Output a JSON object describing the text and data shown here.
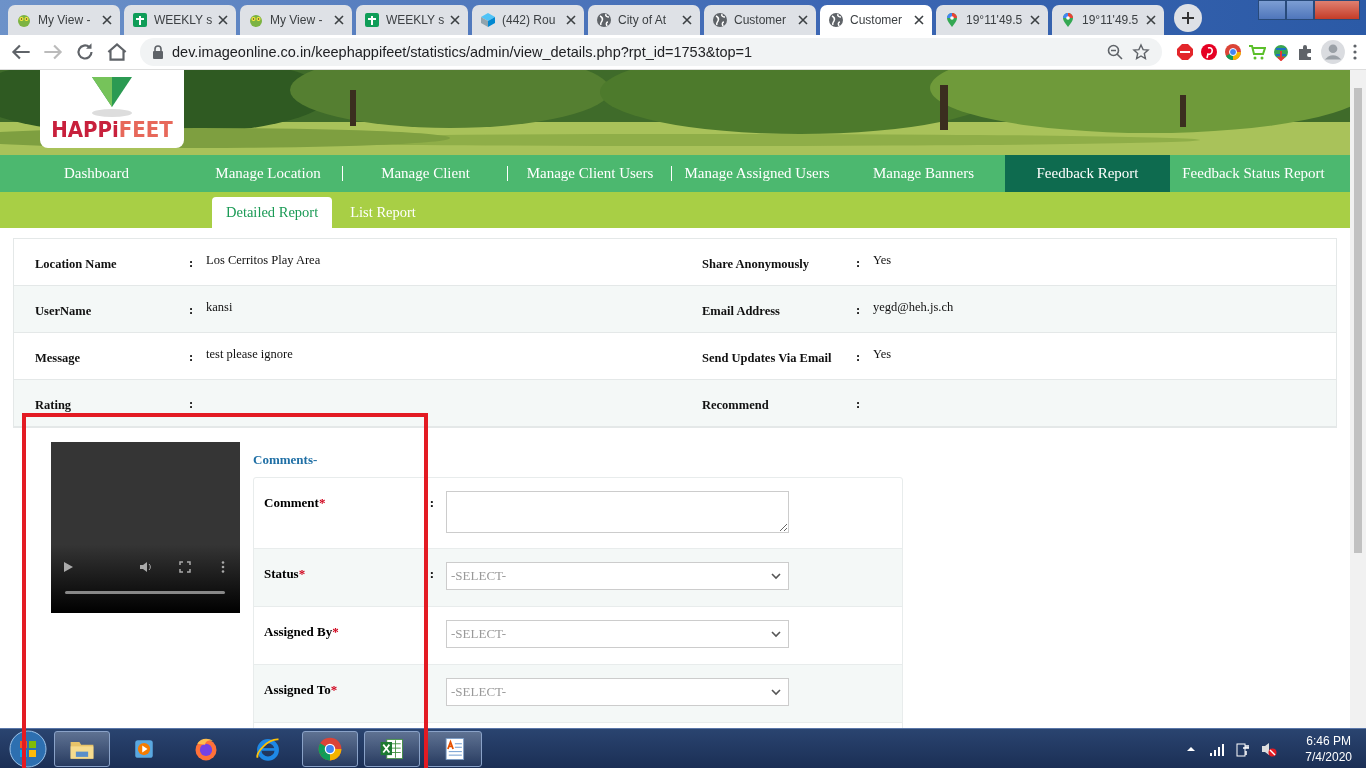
{
  "browser": {
    "tabs": [
      {
        "title": "My View -",
        "kind": "bug",
        "selected": false
      },
      {
        "title": "WEEKLY s",
        "kind": "sheet",
        "selected": false
      },
      {
        "title": "My View -",
        "kind": "bug",
        "selected": false
      },
      {
        "title": "WEEKLY s",
        "kind": "sheet",
        "selected": false
      },
      {
        "title": "(442) Rou",
        "kind": "cube",
        "selected": false
      },
      {
        "title": "City of At",
        "kind": "globe",
        "selected": false
      },
      {
        "title": "Customer",
        "kind": "globe",
        "selected": false
      },
      {
        "title": "Customer",
        "kind": "globe",
        "selected": true
      },
      {
        "title": "19°11'49.5",
        "kind": "pin",
        "selected": false
      },
      {
        "title": "19°11'49.5",
        "kind": "pin",
        "selected": false
      }
    ],
    "address": "dev.imageonline.co.in/keephappifeet/statistics/admin/view_details.php?rpt_id=1753&top=1"
  },
  "logo": {
    "part_1": "HAPPi",
    "part_2": "FEET"
  },
  "nav": [
    {
      "label": "Dashboard",
      "selected": false,
      "divider_after": false
    },
    {
      "label": "Manage Location",
      "selected": false,
      "divider_after": true
    },
    {
      "label": "Manage Client",
      "selected": false,
      "divider_after": true
    },
    {
      "label": "Manage Client Users",
      "selected": false,
      "divider_after": true
    },
    {
      "label": "Manage Assigned Users",
      "selected": false,
      "divider_after": false
    },
    {
      "label": "Manage Banners",
      "selected": false,
      "divider_after": false
    },
    {
      "label": "Feedback Report",
      "selected": true,
      "divider_after": false
    },
    {
      "label": "Feedback Status Report",
      "selected": false,
      "divider_after": false
    }
  ],
  "subtabs": [
    {
      "label": "Detailed Report",
      "selected": true
    },
    {
      "label": "List Report",
      "selected": false
    }
  ],
  "details": [
    {
      "left_label": "Location Name",
      "left_colon": ":",
      "left_value": "Los Cerritos Play Area",
      "right_label": "Share Anonymously",
      "right_colon": ":",
      "right_value": "Yes"
    },
    {
      "left_label": "UserName",
      "left_colon": ":",
      "left_value": "kansi",
      "right_label": "Email Address",
      "right_colon": ":",
      "right_value": "yegd@heh.js.ch"
    },
    {
      "left_label": "Message",
      "left_colon": ":",
      "left_value": "test please ignore",
      "right_label": "Send Updates Via Email",
      "right_colon": ":",
      "right_value": "Yes"
    },
    {
      "left_label": "Rating",
      "left_colon": ":",
      "right_label": "Recommend",
      "right_colon": ":"
    }
  ],
  "comments": {
    "title": "Comments-",
    "fields": [
      {
        "label": "Comment",
        "required_mark": "*",
        "colon": ":",
        "kind": "textarea"
      },
      {
        "label": "Status",
        "required_mark": "*",
        "colon": ":",
        "kind": "select",
        "placeholder": "-SELECT-"
      },
      {
        "label": "Assigned By",
        "required_mark": "*",
        "kind": "select",
        "placeholder": "-SELECT-"
      },
      {
        "label": "Assigned To",
        "required_mark": "*",
        "kind": "select",
        "placeholder": "-SELECT-"
      }
    ]
  },
  "taskbar": {
    "apps": [
      {
        "kind": "folder",
        "running": true
      },
      {
        "kind": "media",
        "running": false
      },
      {
        "kind": "firefox",
        "running": false
      },
      {
        "kind": "ie",
        "running": false
      },
      {
        "kind": "chrome",
        "running": true
      },
      {
        "kind": "excel",
        "running": true
      },
      {
        "kind": "doc",
        "running": true
      }
    ],
    "time": "6:46 PM",
    "date": "7/4/2020"
  }
}
